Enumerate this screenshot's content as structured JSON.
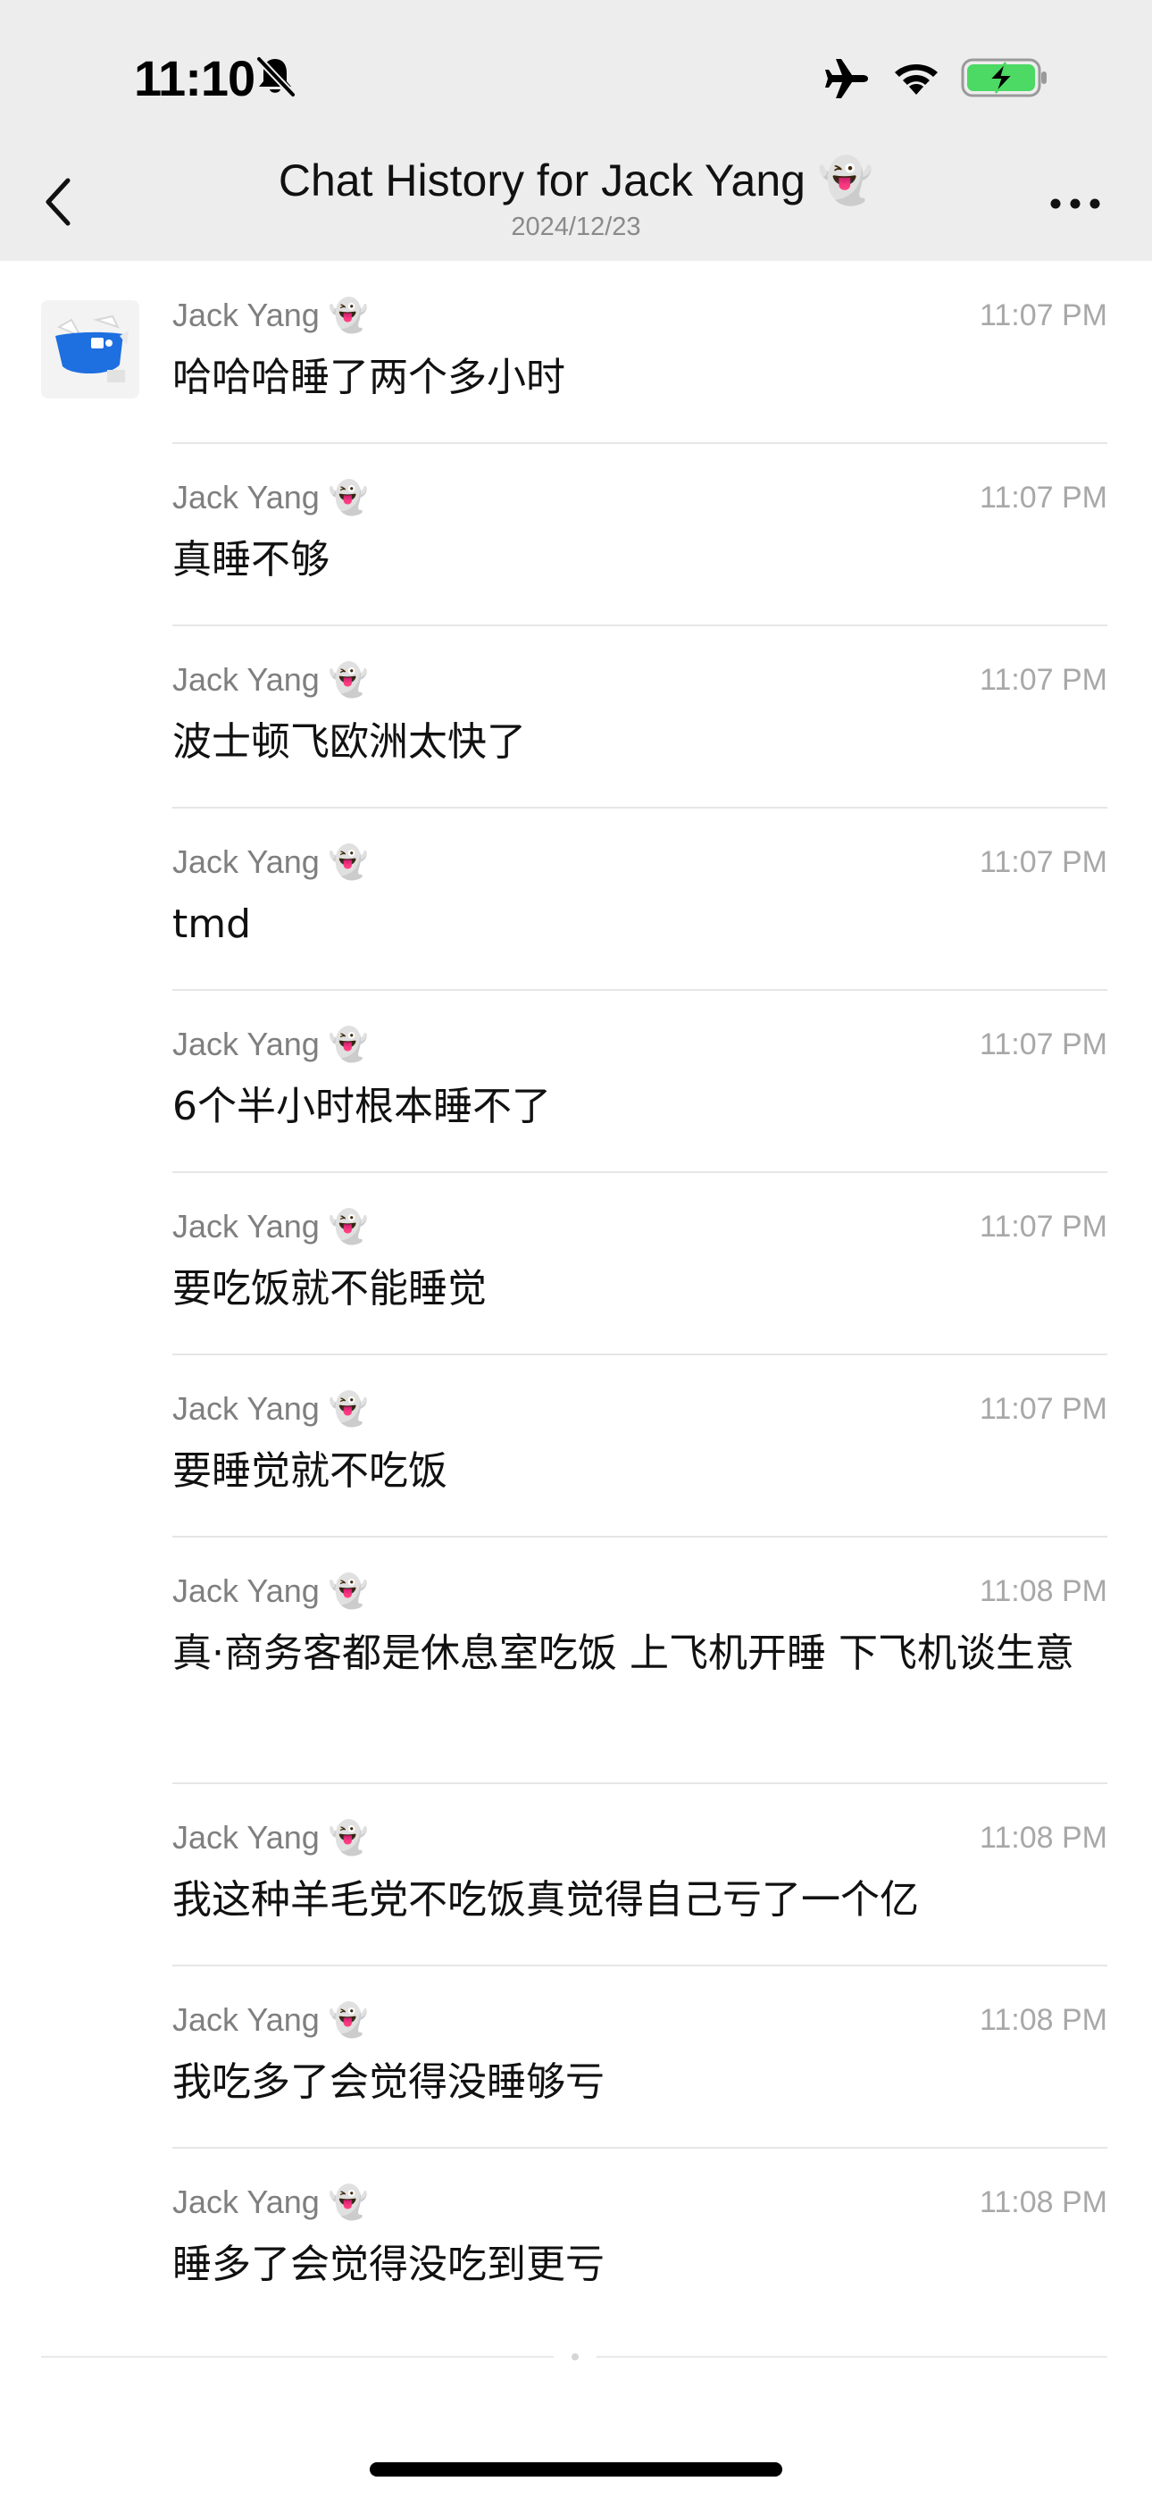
{
  "status_bar": {
    "time": "11:10",
    "icons": [
      "bell-slash-icon",
      "airplane-icon",
      "wifi-icon",
      "battery-charging-icon"
    ],
    "battery_color": "#4cd964"
  },
  "nav": {
    "title": "Chat History for Jack Yang 👻",
    "subtitle": "2024/12/23",
    "back_icon": "chevron-left-icon",
    "more_icon": "more-dots-icon"
  },
  "messages": [
    {
      "sender": "Jack Yang 👻",
      "time": "11:07 PM",
      "text": "哈哈哈睡了两个多小时"
    },
    {
      "sender": "Jack Yang 👻",
      "time": "11:07 PM",
      "text": "真睡不够"
    },
    {
      "sender": "Jack Yang 👻",
      "time": "11:07 PM",
      "text": "波士顿飞欧洲太快了"
    },
    {
      "sender": "Jack Yang 👻",
      "time": "11:07 PM",
      "text": "tmd"
    },
    {
      "sender": "Jack Yang 👻",
      "time": "11:07 PM",
      "text": "6个半小时根本睡不了"
    },
    {
      "sender": "Jack Yang 👻",
      "time": "11:07 PM",
      "text": "要吃饭就不能睡觉"
    },
    {
      "sender": "Jack Yang 👻",
      "time": "11:07 PM",
      "text": "要睡觉就不吃饭"
    },
    {
      "sender": "Jack Yang 👻",
      "time": "11:08 PM",
      "text": "真·商务客都是休息室吃饭 上飞机开睡 下飞机谈生意"
    },
    {
      "sender": "Jack Yang 👻",
      "time": "11:08 PM",
      "text": "我这种羊毛党不吃饭真觉得自己亏了一个亿"
    },
    {
      "sender": "Jack Yang 👻",
      "time": "11:08 PM",
      "text": "我吃多了会觉得没睡够亏"
    },
    {
      "sender": "Jack Yang 👻",
      "time": "11:08 PM",
      "text": "睡多了会觉得没吃到更亏"
    }
  ]
}
